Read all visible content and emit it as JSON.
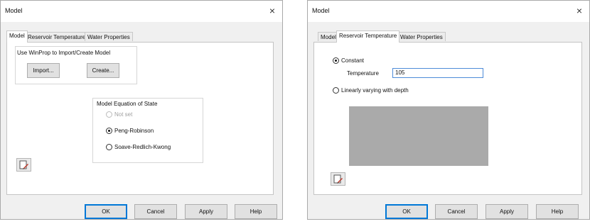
{
  "dialog1": {
    "title": "Model",
    "close": "×",
    "tabs": [
      {
        "label": "Model",
        "active": true
      },
      {
        "label": "Reservoir Temperature",
        "active": false
      },
      {
        "label": "Water Properties",
        "active": false
      }
    ],
    "winprop_label": "Use WinProp to Import/Create Model",
    "import_button": "Import...",
    "create_button": "Create...",
    "eos_group_title": "Model Equation of State",
    "eos_options": [
      {
        "label": "Not set",
        "checked": false,
        "enabled": false
      },
      {
        "label": "Peng-Robinson",
        "checked": true,
        "enabled": true
      },
      {
        "label": "Soave-Redlich-Kwong",
        "checked": false,
        "enabled": true
      }
    ],
    "footer_buttons": {
      "ok": "OK",
      "cancel": "Cancel",
      "apply": "Apply",
      "help": "Help"
    }
  },
  "dialog2": {
    "title": "Model",
    "close": "×",
    "tabs": [
      {
        "label": "Model",
        "active": false
      },
      {
        "label": "Reservoir Temperature",
        "active": true
      },
      {
        "label": "Water Properties",
        "active": false
      }
    ],
    "constant_option": {
      "label": "Constant",
      "checked": true
    },
    "temperature_label": "Temperature",
    "temperature_value": "105",
    "linear_option": {
      "label": "Linearly varying with depth",
      "checked": false
    },
    "footer_buttons": {
      "ok": "OK",
      "cancel": "Cancel",
      "apply": "Apply",
      "help": "Help"
    }
  },
  "colors": {
    "dialog_bg": "#f0f0f0",
    "panel_bg": "#ffffff",
    "accent": "#0078d7",
    "table_placeholder": "#aaaaaa"
  },
  "icons": {
    "edit_button_icon": "edit-icon",
    "close_icon": "close-icon"
  }
}
